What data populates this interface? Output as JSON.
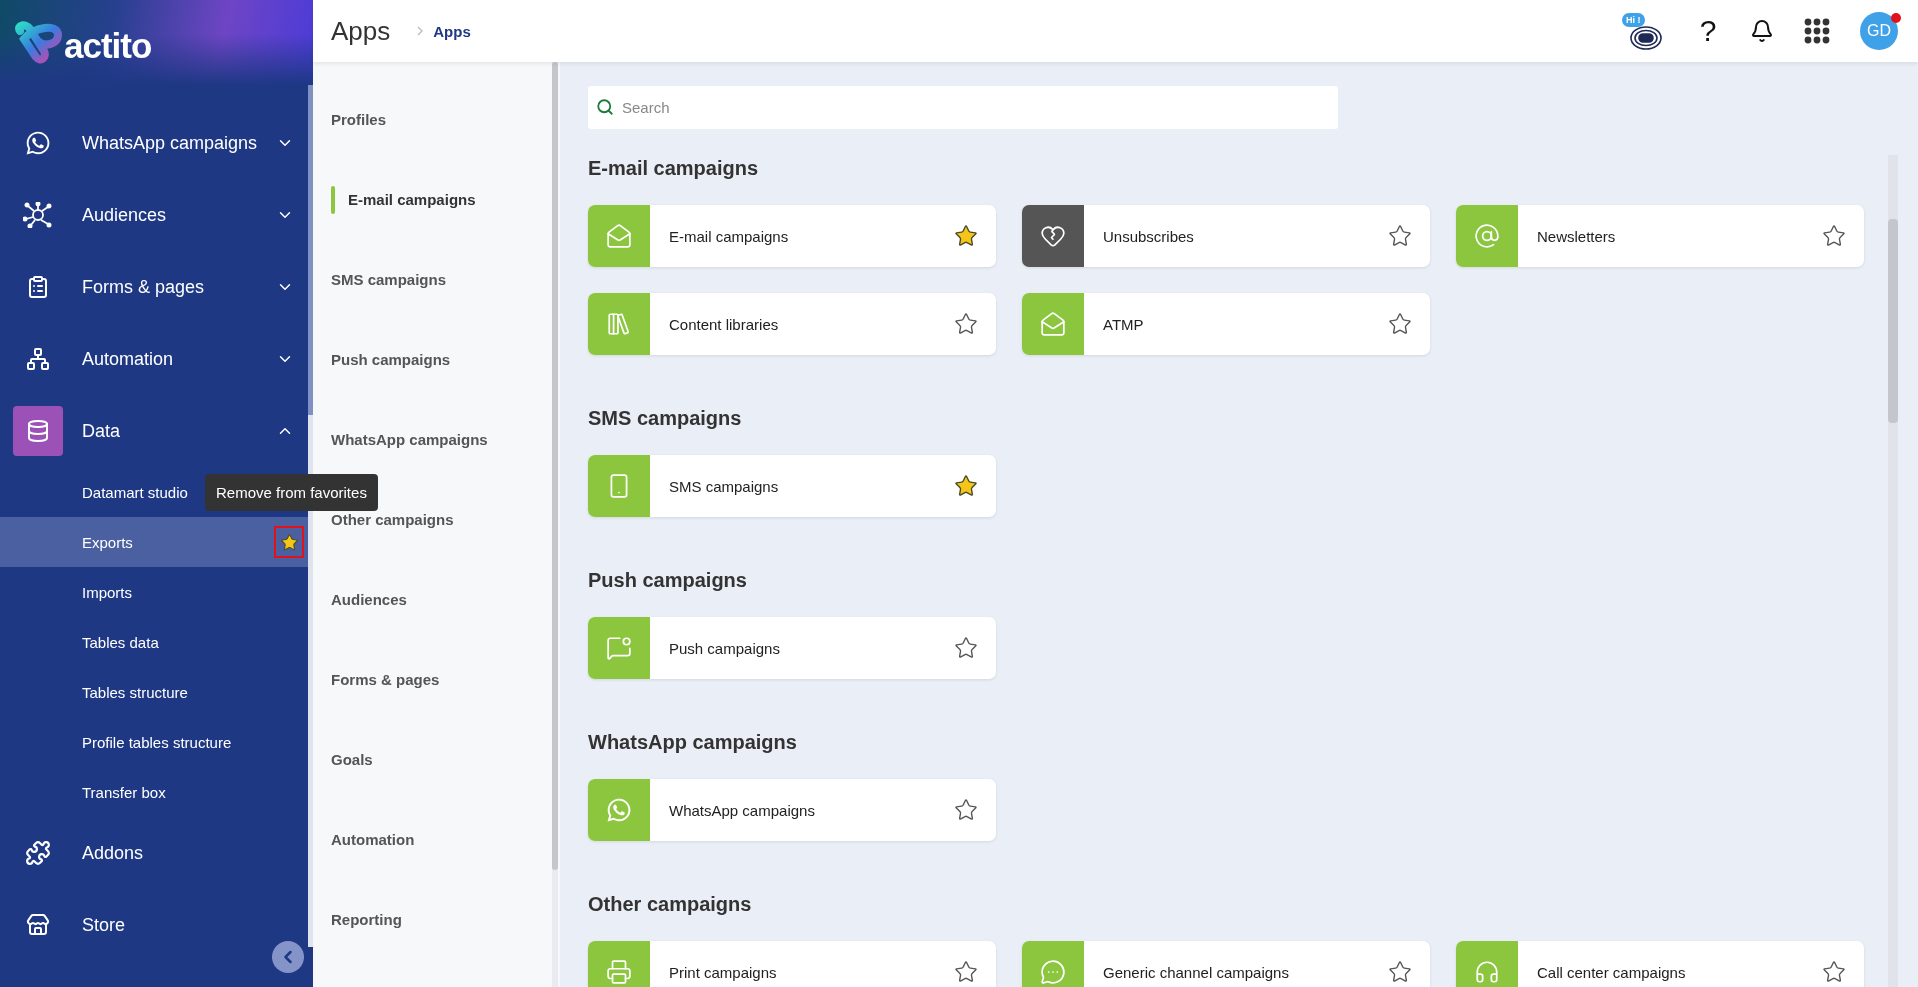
{
  "logo": {
    "text": "actito"
  },
  "sidebar": {
    "items": [
      {
        "kind": "group",
        "label": "WhatsApp campaigns",
        "expanded": false,
        "selected": false
      },
      {
        "kind": "group",
        "label": "Audiences",
        "expanded": false,
        "selected": false
      },
      {
        "kind": "group",
        "label": "Forms & pages",
        "expanded": false,
        "selected": false
      },
      {
        "kind": "group",
        "label": "Automation",
        "expanded": false,
        "selected": false
      },
      {
        "kind": "group",
        "label": "Data",
        "expanded": true,
        "selected": true,
        "children": [
          {
            "label": "Datamart studio",
            "selected": false
          },
          {
            "label": "Exports",
            "selected": true
          },
          {
            "label": "Imports",
            "selected": false
          },
          {
            "label": "Tables data",
            "selected": false
          },
          {
            "label": "Tables structure",
            "selected": false
          },
          {
            "label": "Profile tables structure",
            "selected": false
          },
          {
            "label": "Transfer box",
            "selected": false
          }
        ]
      },
      {
        "kind": "link",
        "label": "Addons",
        "selected": false
      },
      {
        "kind": "link",
        "label": "Store",
        "selected": false
      }
    ],
    "favorite_star": {
      "filled": true,
      "outlined": true
    },
    "tooltip": {
      "text": "Remove from favorites"
    }
  },
  "header": {
    "title": "Apps",
    "breadcrumb": "Apps",
    "bot_badge": "Hi !",
    "help": "?",
    "avatar": "GD",
    "notification": true
  },
  "categories": [
    {
      "label": "Profiles",
      "selected": false
    },
    {
      "label": "E-mail campaigns",
      "selected": true
    },
    {
      "label": "SMS campaigns",
      "selected": false
    },
    {
      "label": "Push campaigns",
      "selected": false
    },
    {
      "label": "WhatsApp campaigns",
      "selected": false
    },
    {
      "label": "Other campaigns",
      "selected": false
    },
    {
      "label": "Audiences",
      "selected": false
    },
    {
      "label": "Forms & pages",
      "selected": false
    },
    {
      "label": "Goals",
      "selected": false
    },
    {
      "label": "Automation",
      "selected": false
    },
    {
      "label": "Reporting",
      "selected": false
    }
  ],
  "search": {
    "placeholder": "Search"
  },
  "sections": [
    {
      "title": "E-mail campaigns",
      "apps": [
        {
          "label": "E-mail campaigns",
          "color": "#8cc63f",
          "favorite": true
        },
        {
          "label": "Unsubscribes",
          "color": "#555555",
          "favorite": false
        },
        {
          "label": "Newsletters",
          "color": "#8cc63f",
          "favorite": false
        },
        {
          "label": "Content libraries",
          "color": "#8cc63f",
          "favorite": false
        },
        {
          "label": "ATMP",
          "color": "#8cc63f",
          "favorite": false
        }
      ]
    },
    {
      "title": "SMS campaigns",
      "apps": [
        {
          "label": "SMS campaigns",
          "color": "#8cc63f",
          "favorite": true
        }
      ]
    },
    {
      "title": "Push campaigns",
      "apps": [
        {
          "label": "Push campaigns",
          "color": "#8cc63f",
          "favorite": false
        }
      ]
    },
    {
      "title": "WhatsApp campaigns",
      "apps": [
        {
          "label": "WhatsApp campaigns",
          "color": "#8cc63f",
          "favorite": false
        }
      ]
    },
    {
      "title": "Other campaigns",
      "apps": [
        {
          "label": "Print campaigns",
          "color": "#8cc63f",
          "favorite": false
        },
        {
          "label": "Generic channel campaigns",
          "color": "#8cc63f",
          "favorite": false
        },
        {
          "label": "Call center campaigns",
          "color": "#8cc63f",
          "favorite": false
        }
      ]
    }
  ]
}
